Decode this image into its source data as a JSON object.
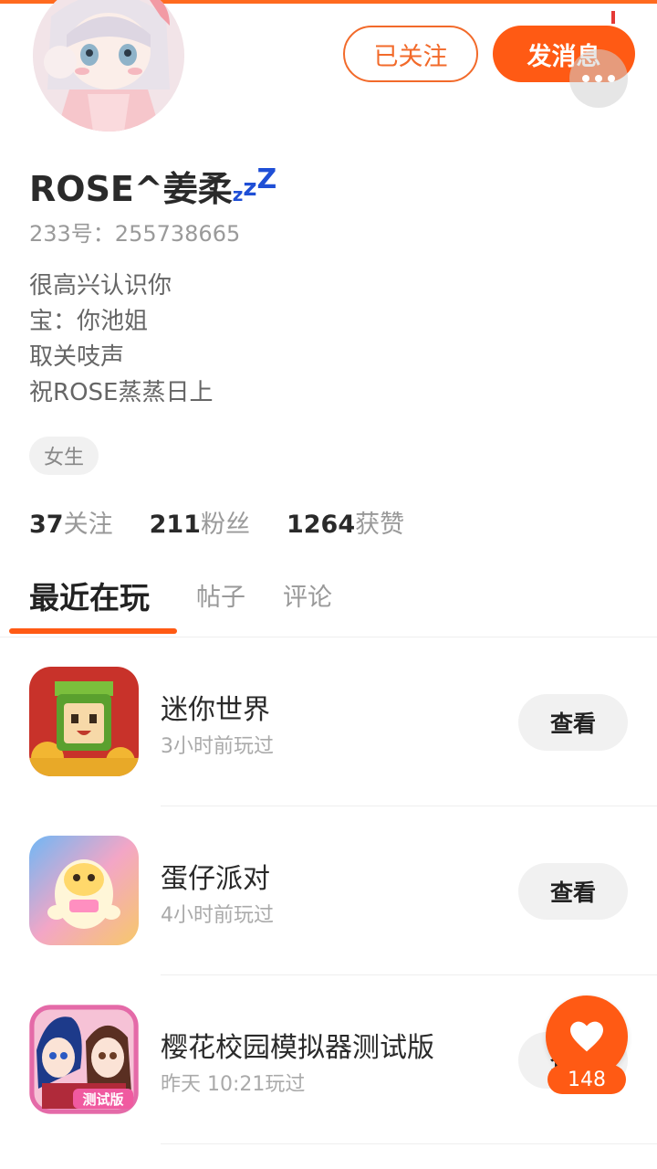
{
  "colors": {
    "accent": "#ff5a14",
    "zzz": "#1f4fd6"
  },
  "header": {
    "followed_label": "已关注",
    "message_label": "发消息",
    "more_icon": "more-dots-icon"
  },
  "profile": {
    "nickname": "ROSE^姜柔",
    "zzz": [
      "z",
      "z",
      "Z"
    ],
    "uid": "233号：255738665",
    "bio": [
      "很高兴认识你",
      "宝：你池姐",
      "取关吱声",
      "祝ROSE蒸蒸日上"
    ],
    "gender_tag": "女生"
  },
  "stats": [
    {
      "num": "37",
      "label": "关注"
    },
    {
      "num": "211",
      "label": "粉丝"
    },
    {
      "num": "1264",
      "label": "获赞"
    }
  ],
  "tabs": [
    "最近在玩",
    "帖子",
    "评论"
  ],
  "games": [
    {
      "name": "迷你世界",
      "time": "3小时前玩过",
      "button": "查看"
    },
    {
      "name": "蛋仔派对",
      "time": "4小时前玩过",
      "button": "查看"
    },
    {
      "name": "樱花校园模拟器测试版",
      "time": "昨天 10:21玩过",
      "button": "查看",
      "icon_badge": "测试版"
    }
  ],
  "like": {
    "count": "148"
  }
}
